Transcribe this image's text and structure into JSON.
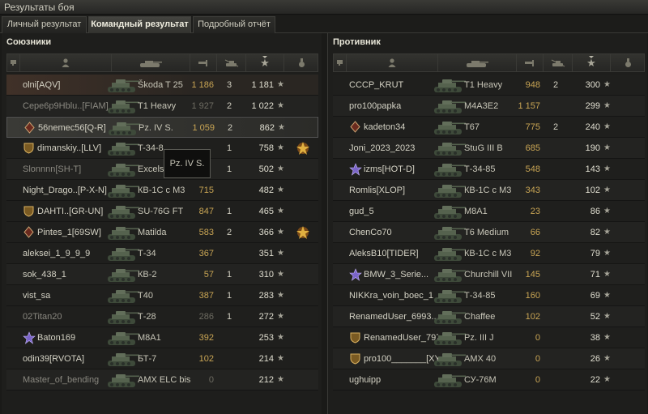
{
  "window": {
    "title": "Результаты боя"
  },
  "tabs": [
    {
      "label": "Личный результат"
    },
    {
      "label": "Командный результат"
    },
    {
      "label": "Подробный отчёт"
    }
  ],
  "left": {
    "title": "Союзники",
    "rows": [
      {
        "name": "olni[AQV]",
        "vehicle": "Škoda T 25",
        "damage": "1 186",
        "kills": "3",
        "xp": "1 181"
      },
      {
        "name": "Cepe6p9Hblu..[FIAM]",
        "vehicle": "T1 Heavy",
        "damage": "1 927",
        "kills": "2",
        "xp": "1 022"
      },
      {
        "name": "56nemec56[Q-R]",
        "vehicle": "Pz. IV S.",
        "damage": "1 059",
        "kills": "2",
        "xp": "862"
      },
      {
        "name": "dimanskiy..[LLV]",
        "vehicle": "T-34-8",
        "damage": "",
        "kills": "1",
        "xp": "758"
      },
      {
        "name": "Slonnnn[SH-T]",
        "vehicle": "Excels",
        "damage": "",
        "kills": "1",
        "xp": "502"
      },
      {
        "name": "Night_Drago..[P-X-N]",
        "vehicle": "КВ-1С с М3",
        "damage": "715",
        "kills": "",
        "xp": "482"
      },
      {
        "name": "DAHTI..[GR-UN]",
        "vehicle": "SU-76G FT",
        "damage": "847",
        "kills": "1",
        "xp": "465"
      },
      {
        "name": "Pintes_1[69SW]",
        "vehicle": "Matilda",
        "damage": "583",
        "kills": "2",
        "xp": "366"
      },
      {
        "name": "aleksei_1_9_9_9",
        "vehicle": "Т-34",
        "damage": "367",
        "kills": "",
        "xp": "351"
      },
      {
        "name": "sok_438_1",
        "vehicle": "КВ-2",
        "damage": "57",
        "kills": "1",
        "xp": "310"
      },
      {
        "name": "vist_sa",
        "vehicle": "T40",
        "damage": "387",
        "kills": "1",
        "xp": "283"
      },
      {
        "name": "02Titan20",
        "vehicle": "Т-28",
        "damage": "286",
        "kills": "1",
        "xp": "272"
      },
      {
        "name": "Baton169",
        "vehicle": "M8A1",
        "damage": "392",
        "kills": "",
        "xp": "253"
      },
      {
        "name": "odin39[RVOTA]",
        "vehicle": "БТ-7",
        "damage": "102",
        "kills": "",
        "xp": "214"
      },
      {
        "name": "Master_of_bending",
        "vehicle": "AMX ELC bis",
        "damage": "0",
        "kills": "",
        "xp": "212"
      }
    ]
  },
  "right": {
    "title": "Противник",
    "rows": [
      {
        "name": "CCCP_KRUT",
        "vehicle": "T1 Heavy",
        "damage": "948",
        "kills": "2",
        "xp": "300"
      },
      {
        "name": "pro100papka",
        "vehicle": "M4A3E2",
        "damage": "1 157",
        "kills": "",
        "xp": "299"
      },
      {
        "name": "kadeton34",
        "vehicle": "T67",
        "damage": "775",
        "kills": "2",
        "xp": "240"
      },
      {
        "name": "Joni_2023_2023",
        "vehicle": "StuG III B",
        "damage": "685",
        "kills": "",
        "xp": "190"
      },
      {
        "name": "izms[HOT-D]",
        "vehicle": "Т-34-85",
        "damage": "548",
        "kills": "",
        "xp": "143"
      },
      {
        "name": "Romlis[XLOP]",
        "vehicle": "КВ-1С с М3",
        "damage": "343",
        "kills": "",
        "xp": "102"
      },
      {
        "name": "gud_5",
        "vehicle": "M8A1",
        "damage": "23",
        "kills": "",
        "xp": "86"
      },
      {
        "name": "ChenCo70",
        "vehicle": "T6 Medium",
        "damage": "66",
        "kills": "",
        "xp": "82"
      },
      {
        "name": "AleksB10[TIDER]",
        "vehicle": "КВ-1С с М3",
        "damage": "92",
        "kills": "",
        "xp": "79"
      },
      {
        "name": "BMW_3_Serie...",
        "vehicle": "Churchill VII",
        "damage": "145",
        "kills": "",
        "xp": "71"
      },
      {
        "name": "NIKKra_voin_boec_1",
        "vehicle": "Т-34-85",
        "damage": "160",
        "kills": "",
        "xp": "69"
      },
      {
        "name": "RenamedUser_6993...",
        "vehicle": "Chaffee",
        "damage": "102",
        "kills": "",
        "xp": "52"
      },
      {
        "name": "RenamedUser_7973...",
        "vehicle": "Pz. III J",
        "damage": "0",
        "kills": "",
        "xp": "38"
      },
      {
        "name": "pro100_______[XY_]",
        "vehicle": "AMX 40",
        "damage": "0",
        "kills": "",
        "xp": "26"
      },
      {
        "name": "ughuipp",
        "vehicle": "СУ-76М",
        "damage": "0",
        "kills": "",
        "xp": "22"
      }
    ]
  },
  "tooltip": {
    "text": "Pz. IV S."
  },
  "icons": {
    "row_star": "★",
    "header_star": "★"
  }
}
